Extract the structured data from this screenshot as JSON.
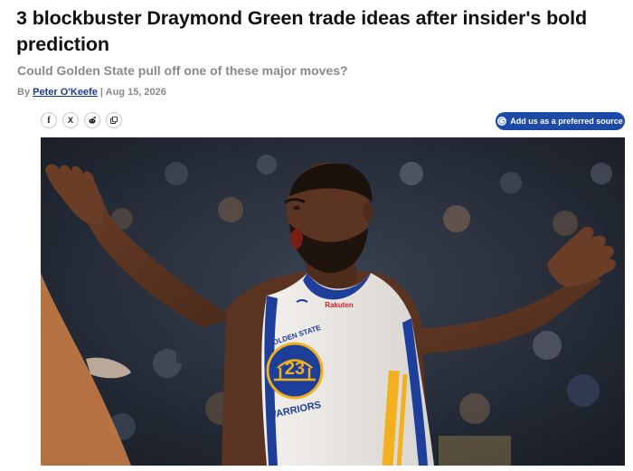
{
  "article": {
    "headline": "3 blockbuster Draymond Green trade ideas after insider's bold prediction",
    "subhead": "Could Golden State pull off one of these major moves?",
    "byline_prefix": "By",
    "author": "Peter O'Keefe",
    "separator": "|",
    "date": "Aug 15, 2026"
  },
  "share": {
    "buttons": [
      {
        "icon": "facebook-icon",
        "glyph": "f"
      },
      {
        "icon": "x-icon",
        "glyph": "X"
      },
      {
        "icon": "reddit-icon"
      },
      {
        "icon": "copy-link-icon"
      }
    ]
  },
  "preferred_source": {
    "label": "Add us as a preferred source",
    "icon": "google-icon"
  },
  "hero_image": {
    "jersey_wordmark_top": "GOLDEN STATE",
    "jersey_number": "23",
    "jersey_wordmark_bottom": "WARRIORS",
    "sponsor": "Rakuten",
    "colors": {
      "jersey": "#ece9e4",
      "trim_blue": "#1d3f9a",
      "trim_gold": "#f2b01e",
      "skin": "#5b3422",
      "crowd": "#2a313c"
    }
  }
}
